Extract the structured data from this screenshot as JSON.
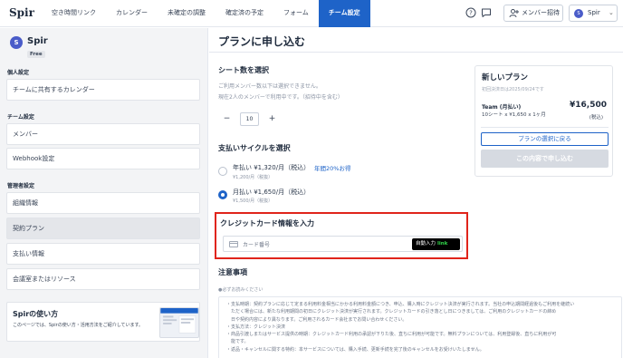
{
  "header": {
    "logo": "Spir",
    "nav": [
      "空き時間リンク",
      "カレンダー",
      "未確定の調整",
      "確定済の予定",
      "フォーム",
      "チーム設定"
    ],
    "active_nav": "チーム設定",
    "icons": [
      "help-icon",
      "chat-icon",
      "add-user-icon",
      "chevron-down-icon"
    ],
    "invite_label": "メンバー招待",
    "account_avatar": "S",
    "account_name": "Spir"
  },
  "sidebar": {
    "workspace_avatar": "S",
    "workspace_name": "Spir",
    "plan_badge": "Free",
    "sections": [
      {
        "title": "個人設定",
        "items": [
          "チームに共有するカレンダー"
        ]
      },
      {
        "title": "チーム設定",
        "items": [
          "メンバー",
          "Webhook設定"
        ]
      },
      {
        "title": "管理者設定",
        "items": [
          "組織情報",
          "契約プラン",
          "支払い情報",
          "会議室またはリソース"
        ]
      }
    ],
    "active_item": "契約プラン",
    "promo": {
      "title": "Spirの使い方",
      "text": "このページでは、Spirの使い方・活用方法をご紹介しています。"
    }
  },
  "main": {
    "title": "プランに申し込む",
    "seats": {
      "title": "シート数を選択",
      "note1": "ご利用メンバー数以下は選択できません。",
      "note2": "現在2人のメンバーで利用中です。（招待中を含む）",
      "minus": "−",
      "value": "10",
      "plus": "+"
    },
    "cycle": {
      "title": "支払いサイクルを選択",
      "options": [
        {
          "label": "年払い ¥1,320/月（税込）",
          "sub": "¥1,200/月（税抜）",
          "badge": "年間20%お得",
          "selected": false
        },
        {
          "label": "月払い ¥1,650/月（税込）",
          "sub": "¥1,500/月（税抜）",
          "badge": "",
          "selected": true
        }
      ]
    },
    "card": {
      "title": "クレジットカード情報を入力",
      "placeholder": "カード番号",
      "autofill_label": "自動入力",
      "autofill_link": "link",
      "highlight_color": "#e0241b"
    },
    "notes": {
      "title": "注意事項",
      "subtitle": "●必ずお読みください",
      "lines": [
        "・支払時期：契約プランに応じて定まる利用料金相当にかかる利用料金額につき、申込、購入時にクレジット決済が実行されます。当社の申込期間経過後もご利用を継続い",
        "　ただく場合には、新たな利用期間の初日にクレジット決済が実行されます。クレジットカードの引き落とし日につきましては、ご利用のクレジットカードの締め",
        "　日や契約内容により異なります。ご利用されるカード会社までお問い合わせください。",
        "・支払方法：クレジット決済",
        "・商品引渡しまたはサービス提供の時期：クレジットカード利用の承認が下りた後、直ちに利用が可能です。無料プランについては、利用登録後、直ちに利用が可",
        "　能です。",
        "・返品・キャンセルに関する特約：本サービスについては、購入手続、更新手続を完了後のキャンセルをお受けいたしません。"
      ]
    }
  },
  "plan": {
    "title": "新しいプラン",
    "date": "初回決済日は2025/09/24です",
    "name": "Team (月払い)",
    "detail": "10シート x ¥1,650 x 1ヶ月",
    "price": "¥16,500",
    "tax": "(税込)",
    "back_label": "プランの選択に戻る",
    "apply_label": "この内容で申し込む"
  },
  "colors": {
    "accent": "#1e63c8",
    "highlight": "#e0241b",
    "sidebar_bg": "#f3f4f6"
  }
}
